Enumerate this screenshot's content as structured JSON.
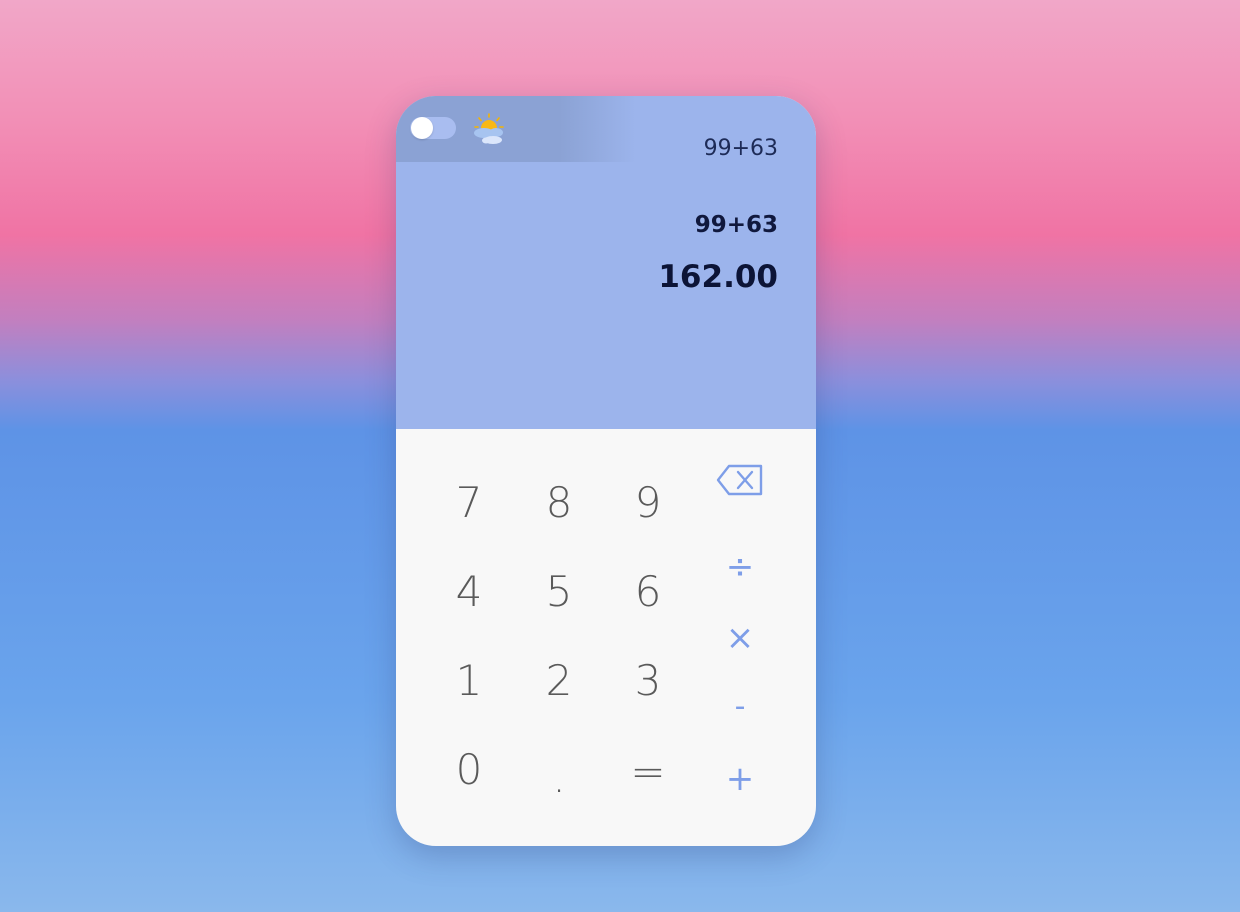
{
  "theme": {
    "display_bg": "#9cb4ec",
    "keypad_bg": "#f8f8f8",
    "digit_color": "#5a5a5a",
    "operator_color": "#7e9ee8"
  },
  "header": {
    "theme_toggle_icon": "toggle-switch",
    "weather_icon": "sun-behind-cloud-icon"
  },
  "display": {
    "history": "99+63",
    "expression": "99+63",
    "result": "162.00"
  },
  "keys": {
    "seven": "7",
    "eight": "8",
    "nine": "9",
    "four": "4",
    "five": "5",
    "six": "6",
    "one": "1",
    "two": "2",
    "three": "3",
    "zero": "0",
    "decimal": ".",
    "equals": "="
  },
  "operators": {
    "backspace_icon": "backspace-icon",
    "divide": "÷",
    "multiply": "×",
    "subtract": "-",
    "add": "+"
  }
}
